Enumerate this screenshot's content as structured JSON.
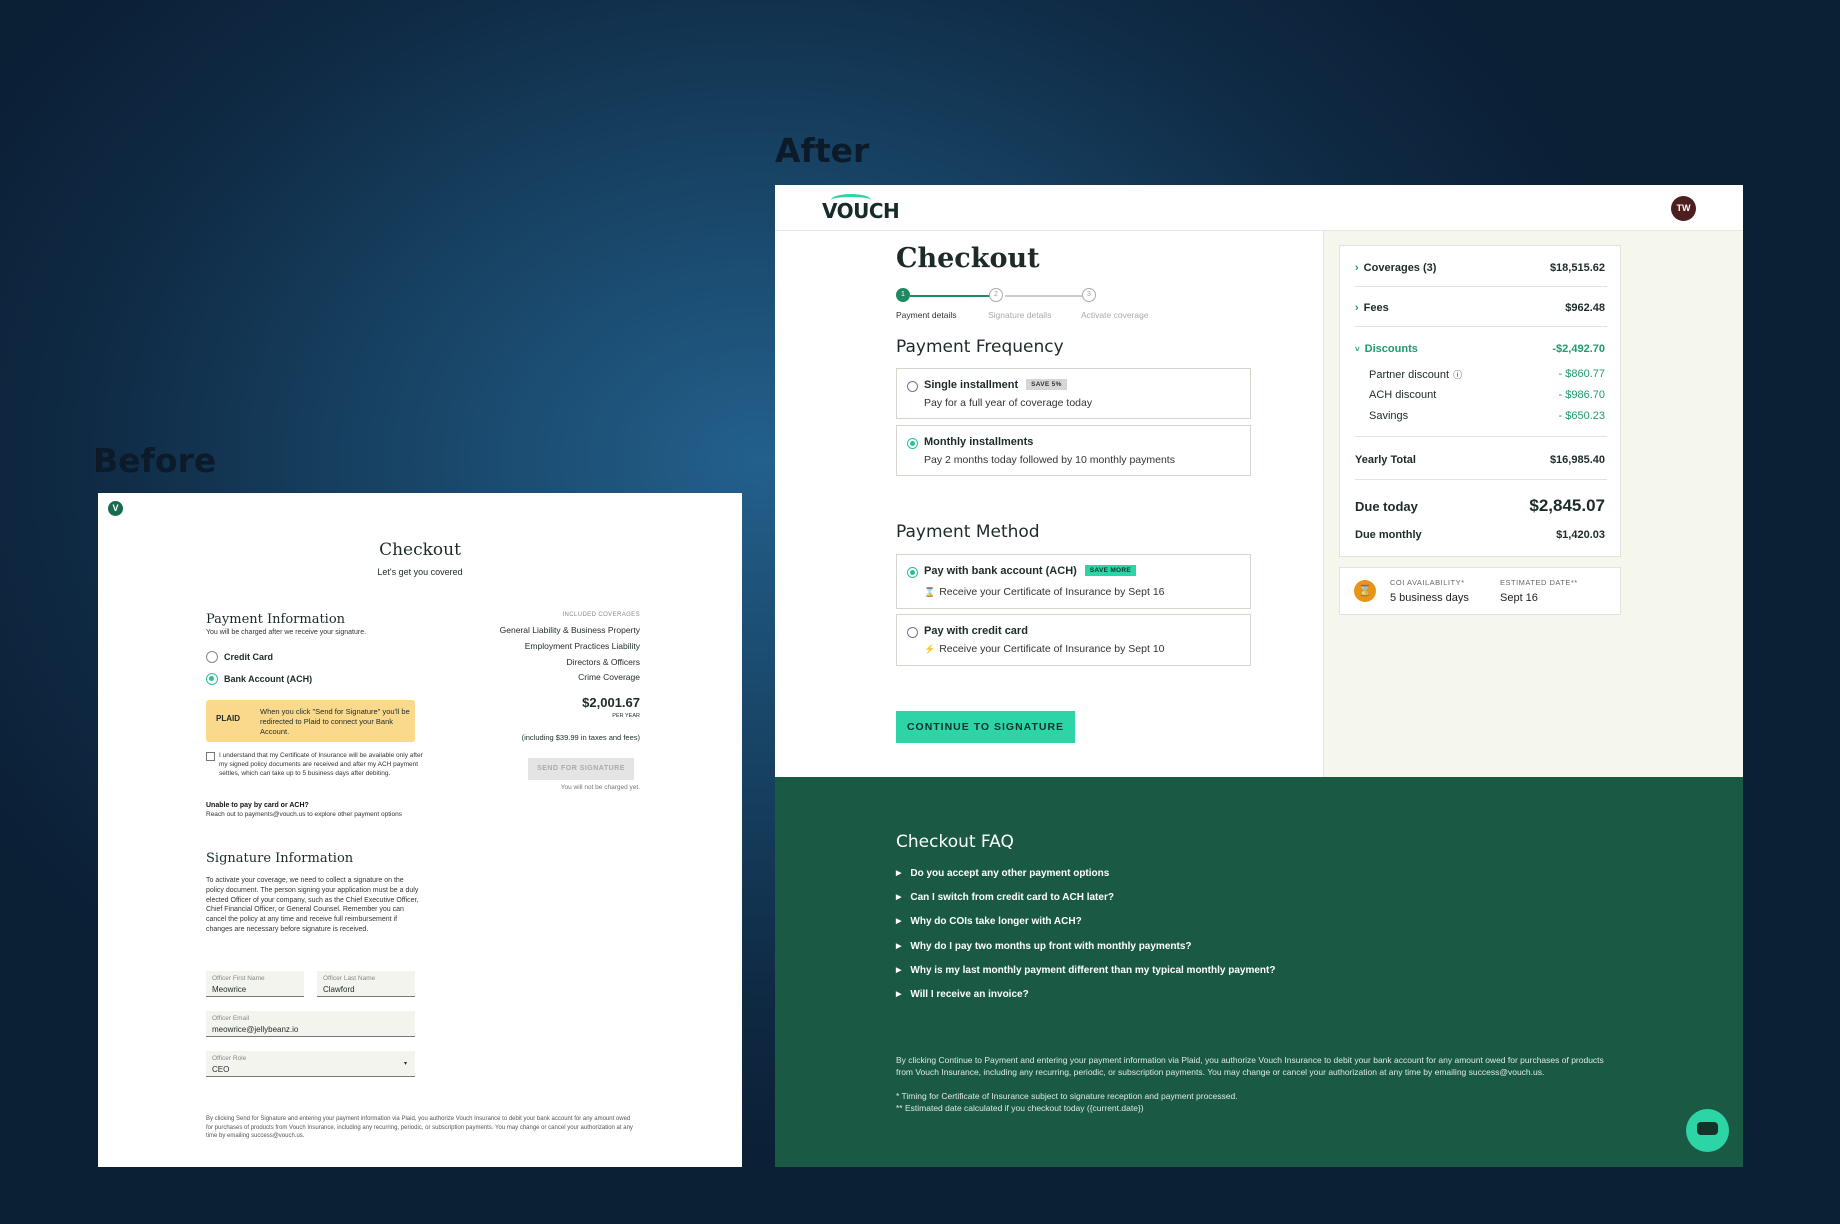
{
  "labels": {
    "before": "Before",
    "after": "After"
  },
  "before": {
    "logo_letter": "V",
    "title": "Checkout",
    "subtitle": "Let's get you covered",
    "payment_heading": "Payment Information",
    "payment_note": "You will be charged after we receive your signature.",
    "option_credit": "Credit Card",
    "option_bank": "Bank Account (ACH)",
    "plaid_logo": "PLAID",
    "plaid_text": "When you click \"Send for Signature\" you'll be redirected to Plaid to connect your Bank Account.",
    "ack_text": "I understand that my Certificate of Insurance will be available only after my signed policy documents are received and after my ACH payment settles, which can take up to 5 business days after debiting.",
    "unable_title": "Unable to pay by card or ACH?",
    "unable_text": "Reach out to payments@vouch.us to explore other payment options",
    "coverages_label": "INCLUDED COVERAGES",
    "coverages": [
      "General Liability & Business Property",
      "Employment Practices Liability",
      "Directors & Officers",
      "Crime Coverage"
    ],
    "price": "$2,001.67",
    "per_year": "PER YEAR",
    "taxes": "(including $39.99 in taxes and fees)",
    "send_button": "SEND FOR SIGNATURE",
    "not_charged": "You will not be charged yet.",
    "signature_heading": "Signature Information",
    "signature_text": "To activate your coverage, we need to collect a signature on the policy document. The person signing your application must be a duly elected Officer of your company, such as the Chief Executive Officer, Chief Financial Officer, or General Counsel. Remember you can cancel the policy at any time and receive full reimbursement if changes are necessary before signature is received.",
    "fields": {
      "first_label": "Officer First Name",
      "first_value": "Meowrice",
      "last_label": "Officer Last Name",
      "last_value": "Clawford",
      "email_label": "Officer Email",
      "email_value": "meowrice@jellybeanz.io",
      "role_label": "Officer Role",
      "role_value": "CEO"
    },
    "legal": "By clicking Send for Signature and entering your payment information via Plaid, you authorize Vouch Insurance to debit your bank account for any amount owed for purchases of products from Vouch Insurance, including any recurring, periodic, or subscription payments. You may change or cancel your authorization at any time by emailing success@vouch.us."
  },
  "after": {
    "logo": "VOUCH",
    "avatar": "TW",
    "title": "Checkout",
    "steps": [
      {
        "num": "1",
        "label": "Payment details"
      },
      {
        "num": "2",
        "label": "Signature details"
      },
      {
        "num": "3",
        "label": "Activate coverage"
      }
    ],
    "frequency_heading": "Payment Frequency",
    "frequency_options": [
      {
        "title": "Single installment",
        "badge": "SAVE 5%",
        "desc": "Pay for a full year of coverage today"
      },
      {
        "title": "Monthly installments",
        "desc": "Pay 2 months today followed by 10 monthly payments"
      }
    ],
    "method_heading": "Payment Method",
    "method_options": [
      {
        "title": "Pay with bank account (ACH)",
        "badge": "SAVE MORE",
        "icon": "⌛",
        "desc": "Receive your Certificate of Insurance by Sept 16"
      },
      {
        "title": "Pay with credit card",
        "icon": "⚡",
        "desc": "Receive your Certificate of Insurance by Sept 10"
      }
    ],
    "cta": "CONTINUE TO SIGNATURE",
    "summary": {
      "coverages_label": "Coverages (3)",
      "coverages_amount": "$18,515.62",
      "fees_label": "Fees",
      "fees_amount": "$962.48",
      "discounts_label": "Discounts",
      "discounts_amount": "-$2,492.70",
      "partner_label": "Partner discount",
      "partner_amount": "- $860.77",
      "ach_label": "ACH discount",
      "ach_amount": "- $986.70",
      "savings_label": "Savings",
      "savings_amount": "- $650.23",
      "yearly_label": "Yearly Total",
      "yearly_amount": "$16,985.40",
      "due_today_label": "Due today",
      "due_today_amount": "$2,845.07",
      "due_monthly_label": "Due monthly",
      "due_monthly_amount": "$1,420.03"
    },
    "coi": {
      "availability_label": "COI AVAILABILITY*",
      "availability_value": "5 business days",
      "date_label": "ESTIMATED DATE**",
      "date_value": "Sept 16"
    },
    "faq": {
      "title": "Checkout FAQ",
      "questions": [
        "Do you accept any other payment options",
        "Can I switch from credit card to ACH later?",
        "Why do COIs take longer with ACH?",
        "Why do I pay two months up front with monthly payments?",
        "Why is my last monthly payment different than my typical monthly payment?",
        "Will I receive an invoice?"
      ],
      "legal": "By clicking Continue to Payment and entering your payment information via Plaid, you authorize Vouch Insurance to debit your bank account for any amount owed for purchases of products from Vouch Insurance, including any recurring, periodic, or subscription payments. You may change or cancel your authorization at any time by emailing success@vouch.us.",
      "footnote1": "* Timing for Certificate of Insurance subject to signature reception and payment processed.",
      "footnote2": "** Estimated date calculated if you checkout today ({current.date})"
    }
  },
  "colors": {
    "accent": "#2cd4a6",
    "faq_bg": "#1a5a44",
    "discount_green": "#1d9b6c"
  }
}
